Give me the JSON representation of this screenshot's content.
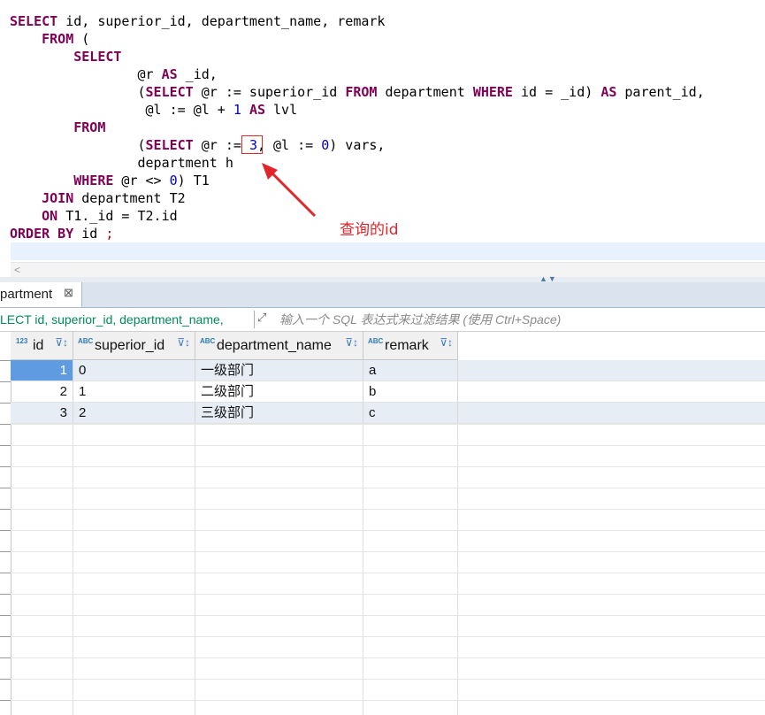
{
  "editor": {
    "lines": [
      {
        "parts": [
          [
            "kw",
            "SELECT"
          ],
          [
            "t",
            " id, superior_id, department_name, remark"
          ]
        ]
      },
      {
        "parts": [
          [
            "t",
            "    "
          ],
          [
            "kw",
            "FROM"
          ],
          [
            "t",
            " ("
          ]
        ]
      },
      {
        "parts": [
          [
            "t",
            "        "
          ],
          [
            "kw",
            "SELECT"
          ]
        ]
      },
      {
        "parts": [
          [
            "t",
            "                @r "
          ],
          [
            "kw",
            "AS"
          ],
          [
            "t",
            " _id,"
          ]
        ]
      },
      {
        "parts": [
          [
            "t",
            "                ("
          ],
          [
            "kw",
            "SELECT"
          ],
          [
            "t",
            " @r := superior_id "
          ],
          [
            "kw",
            "FROM"
          ],
          [
            "t",
            " department "
          ],
          [
            "kw",
            "WHERE"
          ],
          [
            "t",
            " id = _id) "
          ],
          [
            "kw",
            "AS"
          ],
          [
            "t",
            " parent_id,"
          ]
        ]
      },
      {
        "parts": [
          [
            "t",
            "                 @l := @l + "
          ],
          [
            "num",
            "1"
          ],
          [
            "t",
            " "
          ],
          [
            "kw",
            "AS"
          ],
          [
            "t",
            " lvl"
          ]
        ]
      },
      {
        "parts": [
          [
            "t",
            "        "
          ],
          [
            "kw",
            "FROM"
          ]
        ]
      },
      {
        "parts": [
          [
            "t",
            "                ("
          ],
          [
            "kw",
            "SELECT"
          ],
          [
            "t",
            " @r := "
          ],
          [
            "num",
            "3"
          ],
          [
            "t",
            ", @l := "
          ],
          [
            "num",
            "0"
          ],
          [
            "t",
            ") vars,"
          ]
        ]
      },
      {
        "parts": [
          [
            "t",
            "                department h"
          ]
        ]
      },
      {
        "parts": [
          [
            "t",
            "        "
          ],
          [
            "kw",
            "WHERE"
          ],
          [
            "t",
            " @r <> "
          ],
          [
            "num",
            "0"
          ],
          [
            "t",
            ") T1"
          ]
        ]
      },
      {
        "parts": [
          [
            "t",
            "    "
          ],
          [
            "kw",
            "JOIN"
          ],
          [
            "t",
            " department T2"
          ]
        ]
      },
      {
        "parts": [
          [
            "t",
            "    "
          ],
          [
            "kw",
            "ON"
          ],
          [
            "t",
            " T1._id = T2.id"
          ]
        ]
      },
      {
        "parts": [
          [
            "kw",
            "ORDER BY"
          ],
          [
            "t",
            " id "
          ],
          [
            "semi",
            ";"
          ]
        ]
      }
    ],
    "annotation": "查询的id"
  },
  "results_tab": {
    "label": "partment",
    "close_glyph": "⊠"
  },
  "filter": {
    "query_text": "LECT id, superior_id, department_name,",
    "placeholder": "输入一个 SQL 表达式来过滤结果 (使用 Ctrl+Space)"
  },
  "grid": {
    "columns": [
      {
        "name": "id",
        "type_badge": "123",
        "filter_icon": "sort-filter-icon"
      },
      {
        "name": "superior_id",
        "type_badge": "ABC",
        "filter_icon": "sort-filter-icon"
      },
      {
        "name": "department_name",
        "type_badge": "ABC",
        "filter_icon": "sort-filter-icon"
      },
      {
        "name": "remark",
        "type_badge": "ABC",
        "filter_icon": "sort-filter-icon"
      }
    ],
    "rows": [
      {
        "id": "1",
        "superior_id": "0",
        "department_name": "一级部门",
        "remark": "a"
      },
      {
        "id": "2",
        "superior_id": "1",
        "department_name": "二级部门",
        "remark": "b"
      },
      {
        "id": "3",
        "superior_id": "2",
        "department_name": "三级部门",
        "remark": "c"
      }
    ]
  },
  "colors": {
    "keyword": "#7f0055",
    "number": "#0000c0",
    "annotation": "#e0252b",
    "selected_cell": "#5e9be0",
    "alt_row": "#e6edf5"
  }
}
